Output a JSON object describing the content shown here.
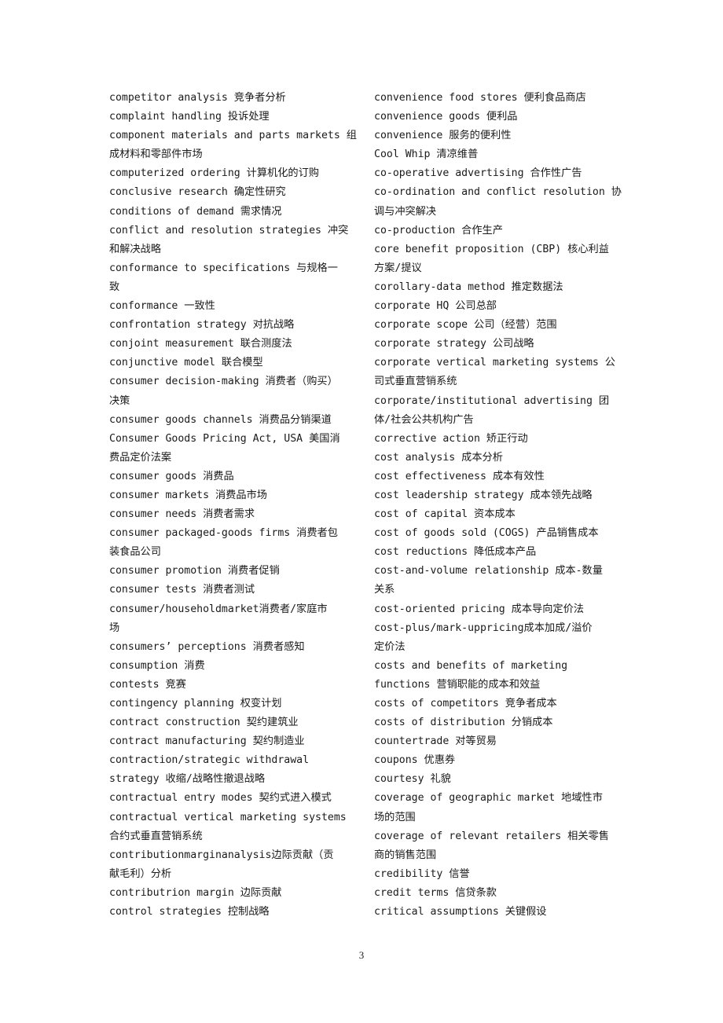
{
  "document": {
    "page_number": "3",
    "left_column": [
      "competitor analysis 竞争者分析",
      "complaint handling 投诉处理",
      "component materials and parts markets 组",
      "成材料和零部件市场",
      "computerized ordering 计算机化的订购",
      "conclusive research 确定性研究",
      "conditions of demand 需求情况",
      "conflict and resolution strategies 冲突",
      "和解决战略",
      "conformance to specifications 与规格一",
      "致",
      "conformance 一致性",
      "confrontation strategy 对抗战略",
      "conjoint measurement 联合测度法",
      "conjunctive model 联合模型",
      "consumer decision-making 消费者（购买）",
      "决策",
      "consumer goods channels 消费品分销渠道",
      "Consumer Goods Pricing Act, USA 美国消",
      "费品定价法案",
      "consumer goods 消费品",
      "consumer markets 消费品市场",
      "consumer needs 消费者需求",
      "consumer packaged-goods firms 消费者包",
      "装食品公司",
      "consumer promotion 消费者促销",
      "consumer tests 消费者测试",
      "consumer/householdmarket消费者/家庭市",
      "场",
      "consumers’ perceptions 消费者感知",
      "consumption 消费",
      "contests 竞赛",
      "contingency planning 权变计划",
      "contract construction 契约建筑业",
      "contract manufacturing 契约制造业",
      "contraction/strategic withdrawal",
      "strategy 收缩/战略性撤退战略",
      "contractual entry modes 契约式进入模式",
      "contractual vertical marketing systems",
      "合约式垂直营销系统",
      "contributionmarginanalysis边际贡献（贡",
      "献毛利）分析",
      "contributrion margin 边际贡献",
      "control strategies 控制战略"
    ],
    "right_column": [
      "convenience food stores 便利食品商店",
      "convenience goods 便利品",
      "convenience 服务的便利性",
      "Cool Whip 清凉维普",
      "co-operative advertising 合作性广告",
      "co-ordination and conflict resolution 协",
      "调与冲突解决",
      "co-production 合作生产",
      "core benefit proposition (CBP) 核心利益",
      "方案/提议",
      "corollary-data method 推定数据法",
      "corporate HQ 公司总部",
      "corporate scope 公司（经营）范围",
      "corporate strategy 公司战略",
      "corporate vertical marketing systems 公",
      "司式垂直营销系统",
      "corporate/institutional advertising 团",
      "体/社会公共机构广告",
      "corrective action 矫正行动",
      "cost analysis 成本分析",
      "cost effectiveness 成本有效性",
      "cost leadership strategy 成本领先战略",
      "cost of capital 资本成本",
      "cost of goods sold (COGS) 产品销售成本",
      "cost reductions 降低成本产品",
      "cost-and-volume relationship 成本-数量",
      "关系",
      "cost-oriented pricing 成本导向定价法",
      "cost-plus/mark-uppricing成本加成/溢价",
      "定价法",
      "costs and benefits of marketing",
      "functions 营销职能的成本和效益",
      "costs of competitors 竞争者成本",
      "costs of distribution 分销成本",
      "countertrade 对等贸易",
      "coupons 优惠券",
      "courtesy 礼貌",
      "coverage of geographic market 地域性市",
      "场的范围",
      "coverage of relevant retailers 相关零售",
      "商的销售范围",
      "credibility 信誉",
      "credit terms 信贷条款",
      "critical assumptions 关键假设"
    ]
  }
}
